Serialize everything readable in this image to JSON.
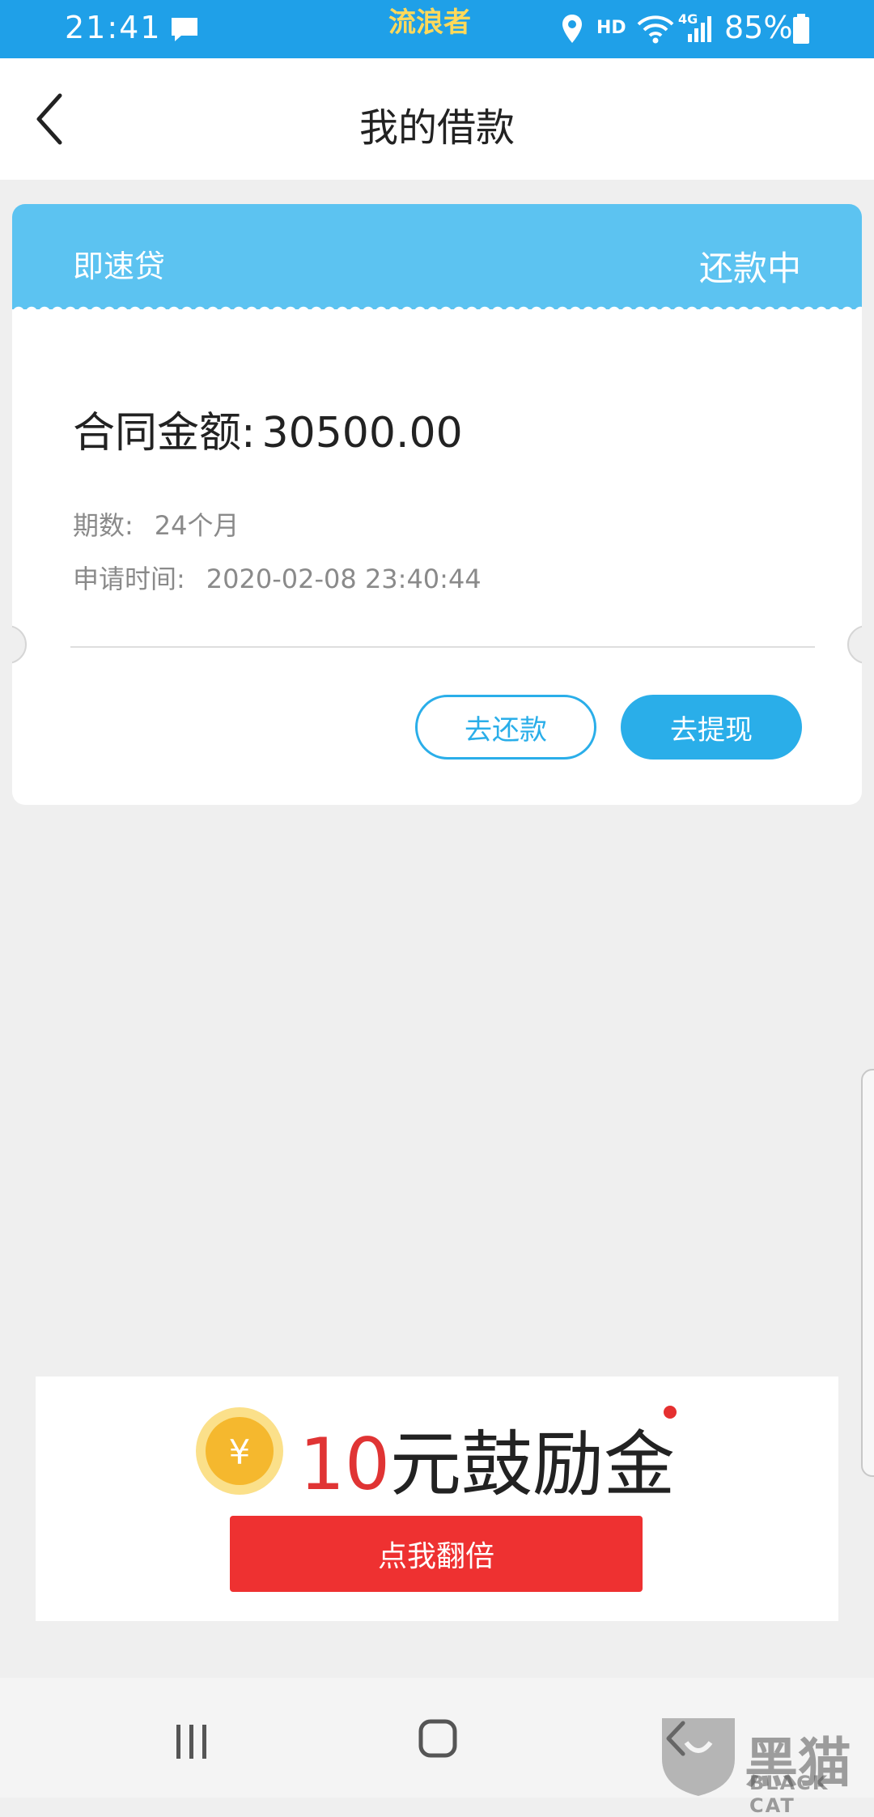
{
  "status_bar": {
    "time": "21:41",
    "carrier_label": "流浪者",
    "network_hd": "HD",
    "network_type": "4G",
    "battery": "85%"
  },
  "header": {
    "title": "我的借款"
  },
  "loan_card": {
    "product_name": "即速贷",
    "status": "还款中",
    "contract_amount_label": "合同金额:",
    "contract_amount_value": "30500.00",
    "term_label": "期数:",
    "term_value": "24个月",
    "apply_time_label": "申请时间:",
    "apply_time_value": "2020-02-08 23:40:44",
    "repay_button": "去还款",
    "withdraw_button": "去提现"
  },
  "promo": {
    "amount": "10",
    "amount_suffix": "元鼓励金",
    "button": "点我翻倍",
    "coin_symbol": "¥"
  },
  "watermark": {
    "text": "黑猫",
    "subtext": "BLACK CAT"
  },
  "colors": {
    "status_bar": "#1fa0e8",
    "card_header": "#5cc3f1",
    "accent_blue": "#2aaee9",
    "promo_red": "#ee3131"
  }
}
